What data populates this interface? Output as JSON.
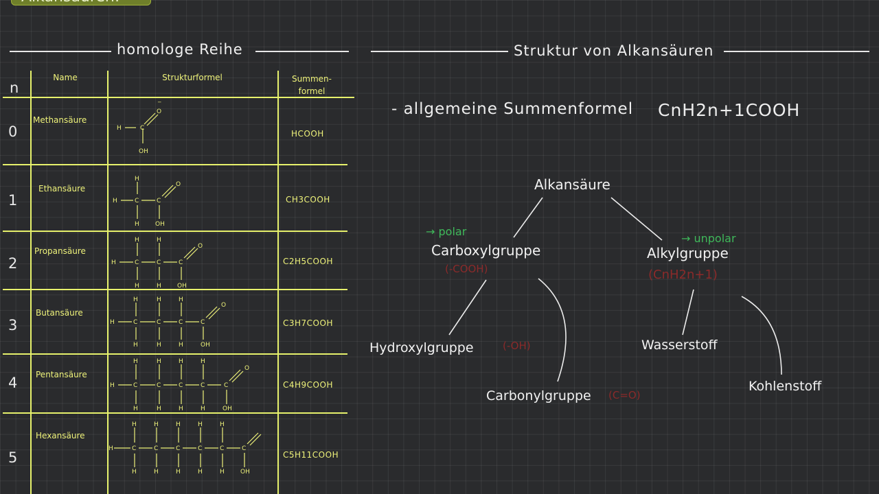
{
  "title_tag": "Alkansäuren:",
  "left": {
    "heading": "homologe Reihe",
    "headers": {
      "n": "n",
      "name": "Name",
      "struct": "Strukturformel",
      "sum": "Summen-formel"
    },
    "rows": [
      {
        "n": "0",
        "name": "Methansäure",
        "sum": "HCOOH"
      },
      {
        "n": "1",
        "name": "Ethansäure",
        "sum": "CH3COOH"
      },
      {
        "n": "2",
        "name": "Propansäure",
        "sum": "C2H5COOH"
      },
      {
        "n": "3",
        "name": "Butansäure",
        "sum": "C3H7COOH"
      },
      {
        "n": "4",
        "name": "Pentansäure",
        "sum": "C4H9COOH"
      },
      {
        "n": "5",
        "name": "Hexansäure",
        "sum": "C5H11COOH"
      }
    ]
  },
  "right": {
    "heading": "Struktur von Alkansäuren",
    "formula_label": "- allgemeine Summenformel",
    "formula": "CnH2n+1COOH",
    "tree": {
      "root": "Alkansäure",
      "carboxyl": "Carboxylgruppe",
      "carboxyl_tag": "→ polar",
      "carboxyl_sub": "(-COOH)",
      "alkyl": "Alkylgruppe",
      "alkyl_tag": "→ unpolar",
      "alkyl_sub": "(CnH2n+1)",
      "hydroxyl": "Hydroxylgruppe",
      "hydroxyl_sub": "(-OH)",
      "carbonyl": "Carbonylgruppe",
      "carbonyl_sub": "(C=O)",
      "wasserstoff": "Wasserstoff",
      "kohlenstoff": "Kohlenstoff"
    }
  },
  "colors": {
    "background": "#2a2b2d",
    "accent_yellow": "#e7f26c",
    "tag_green": "#3fb85a",
    "tag_red": "#8b2a2a"
  }
}
